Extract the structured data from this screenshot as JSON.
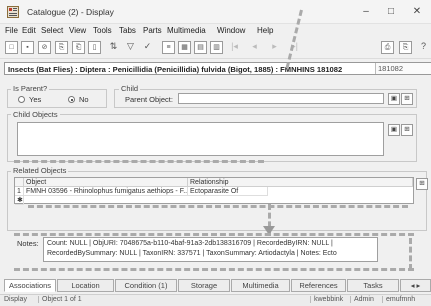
{
  "window": {
    "title": "Catalogue (2) - Display",
    "controls": [
      "–",
      "□",
      "✕"
    ]
  },
  "menu": [
    "File",
    "Edit",
    "Select",
    "View",
    "Tools",
    "Tabs",
    "Parts",
    "Multimedia",
    "Window",
    "Help"
  ],
  "record": {
    "title": "Insects (Bat Flies) : Diptera : Penicillidia (Penicillidia) fulvida (Bigot, 1885) : FMNHINS 181082",
    "id": "181082"
  },
  "parent": {
    "legend_is_parent": "Is Parent?",
    "yes_label": "Yes",
    "no_label": "No",
    "is_parent_value": "No",
    "legend_child": "Child",
    "parent_object_label": "Parent Object:",
    "parent_object_value": ""
  },
  "child_objects": {
    "legend": "Child Objects"
  },
  "related_objects": {
    "legend": "Related Objects",
    "columns": [
      "Object",
      "Relationship"
    ],
    "rows": [
      {
        "num": "1",
        "object": "FMNH 03596 - Rhinolophus fumigatus aethiops - F...",
        "relationship": "Ectoparasite Of"
      }
    ],
    "new_row_marker": "✱"
  },
  "notes": {
    "label": "Notes:",
    "value": "Count: NULL | ObjURI: 7048675a-b110-4baf-91a3-2db138316709 | RecordedByIRN: NULL | RecordedBySummary: NULL | TaxonIRN: 337571 | TaxonSummary: Artiodactyla | Notes: Ecto"
  },
  "tabs": [
    "Associations",
    "Location",
    "Condition (1)",
    "Storage",
    "Multimedia",
    "References",
    "Tasks"
  ],
  "active_tab": "Associations",
  "status": {
    "mode": "Display",
    "position": "Object 1 of 1",
    "user": "kwebbink",
    "role": "Admin",
    "db": "emufmnh"
  },
  "icons": {
    "app": "catalogue-app-icon",
    "accent": "#c0392b"
  }
}
